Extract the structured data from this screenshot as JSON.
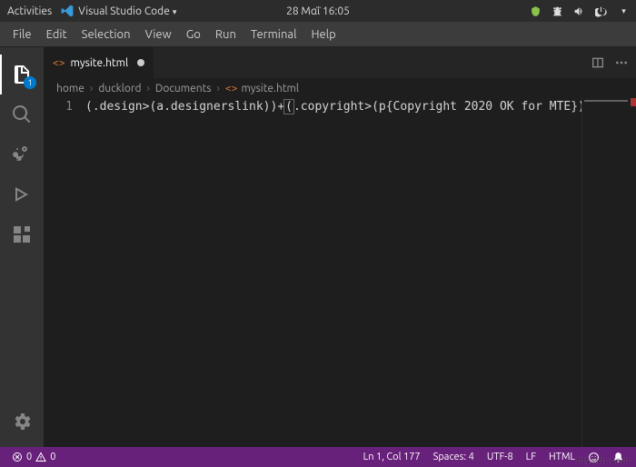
{
  "topbar": {
    "activities": "Activities",
    "app_name": "Visual Studio Code",
    "clock": "28 Μαΐ 16:05"
  },
  "menu": {
    "file": "File",
    "edit": "Edit",
    "selection": "Selection",
    "view": "View",
    "go": "Go",
    "run": "Run",
    "terminal": "Terminal",
    "help": "Help"
  },
  "activitybar": {
    "explorer_badge": "1"
  },
  "tab": {
    "filename": "mysite.html"
  },
  "breadcrumbs": {
    "seg0": "home",
    "seg1": "ducklord",
    "seg2": "Documents",
    "seg3": "mysite.html"
  },
  "editor": {
    "line_number": "1",
    "code_pre": "(.design>(a.designerslink))+",
    "code_bracket1": "(",
    "code_mid": ".copyright>(p{Copyright 2020 OK for MTE})",
    "code_bracket2": ")"
  },
  "status": {
    "errors": "0",
    "warnings": "0",
    "ln_col": "Ln 1, Col 177",
    "spaces": "Spaces: 4",
    "encoding": "UTF-8",
    "eol": "LF",
    "language": "HTML"
  },
  "watermark": "myskn.com"
}
